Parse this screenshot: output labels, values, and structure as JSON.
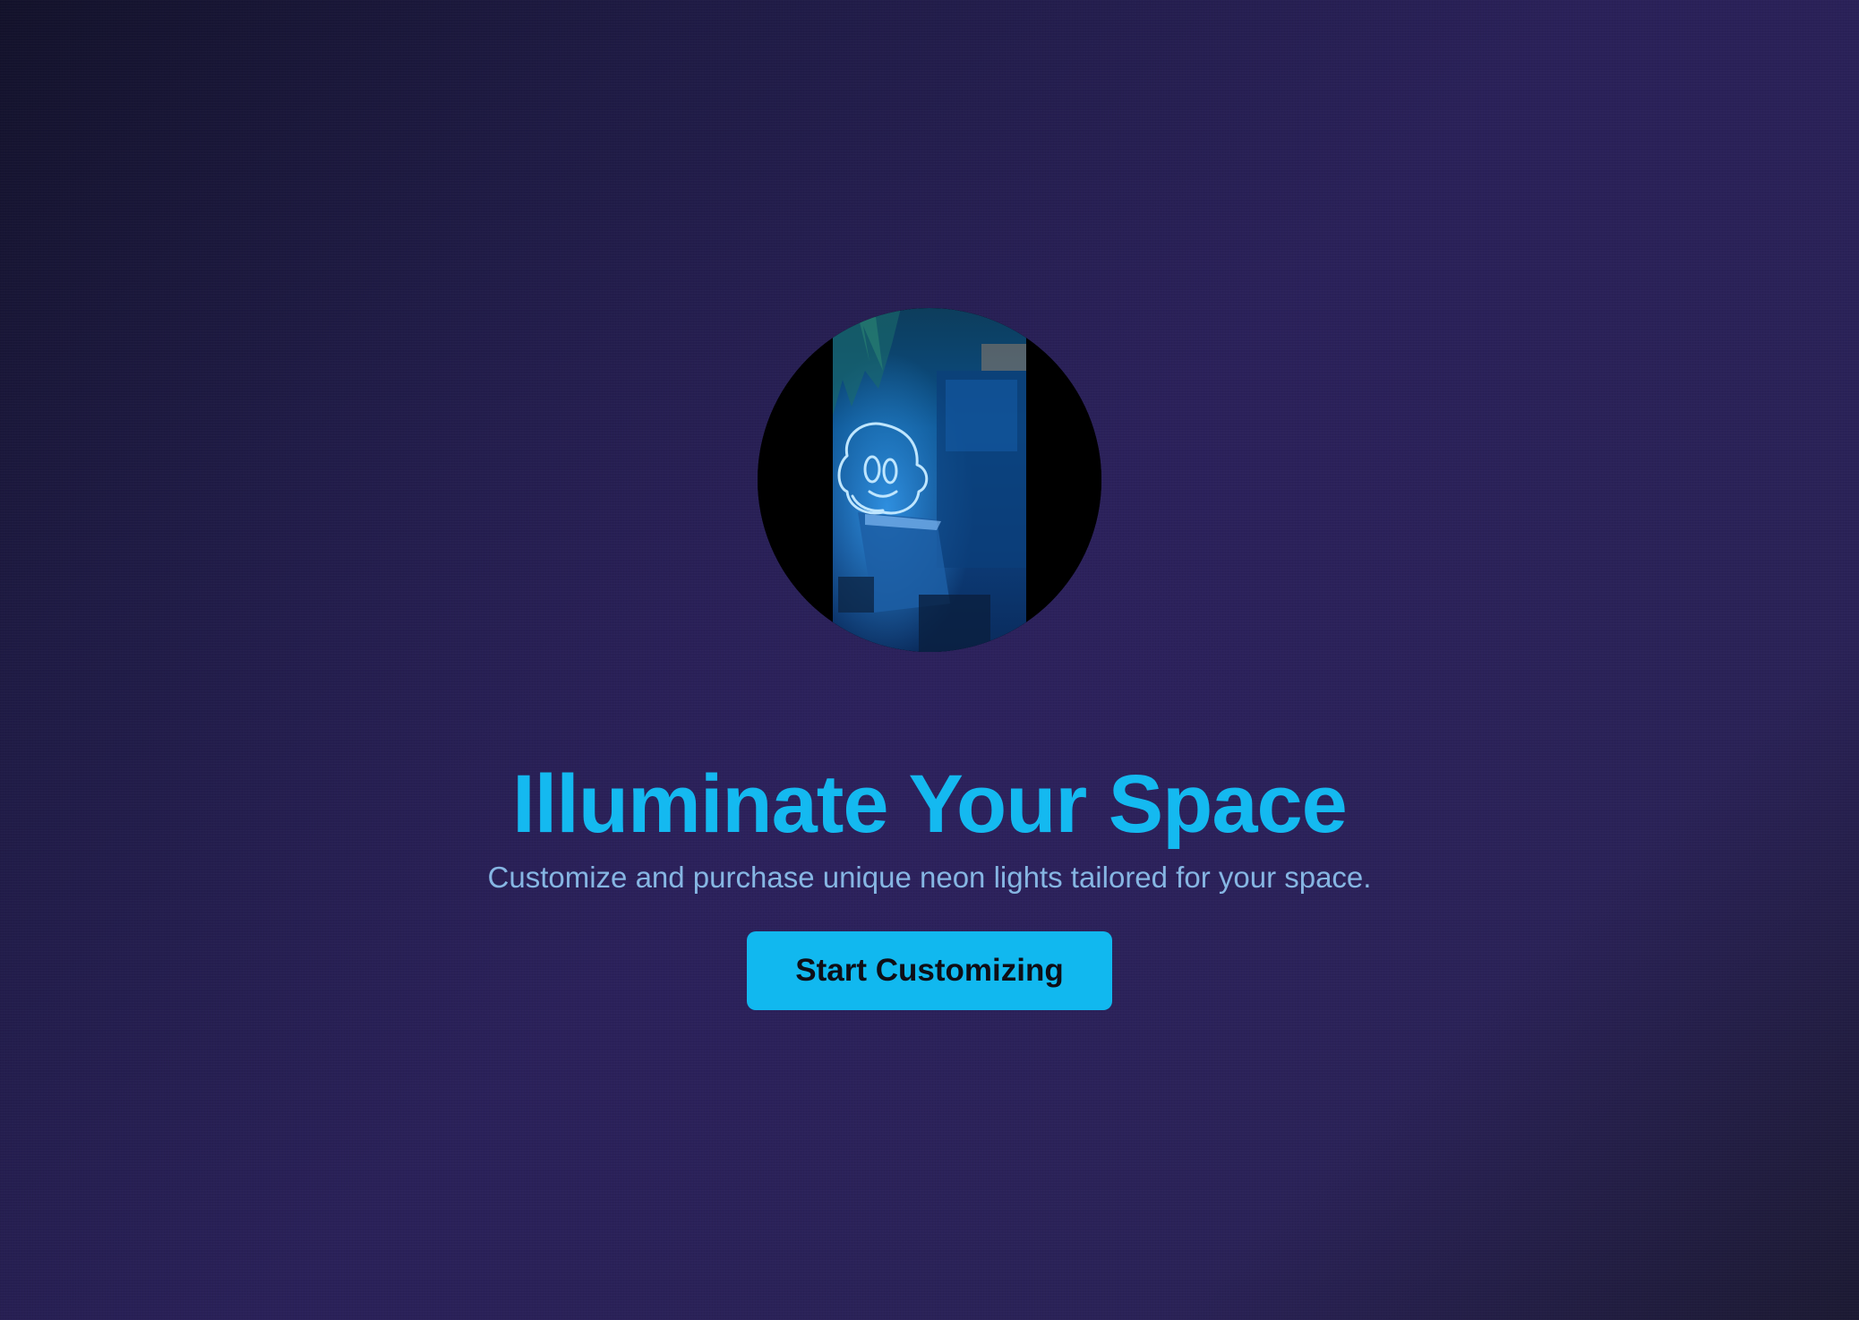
{
  "hero": {
    "headline": "Illuminate Your Space",
    "subtitle": "Customize and purchase unique neon lights tailored for your space.",
    "cta_label": "Start Customizing",
    "media_icon": "neon-face-sign-icon"
  },
  "colors": {
    "accent": "#14b9f0",
    "button": "#11b8ef",
    "subtitle": "#86b6e3",
    "background": "#2a2159"
  }
}
